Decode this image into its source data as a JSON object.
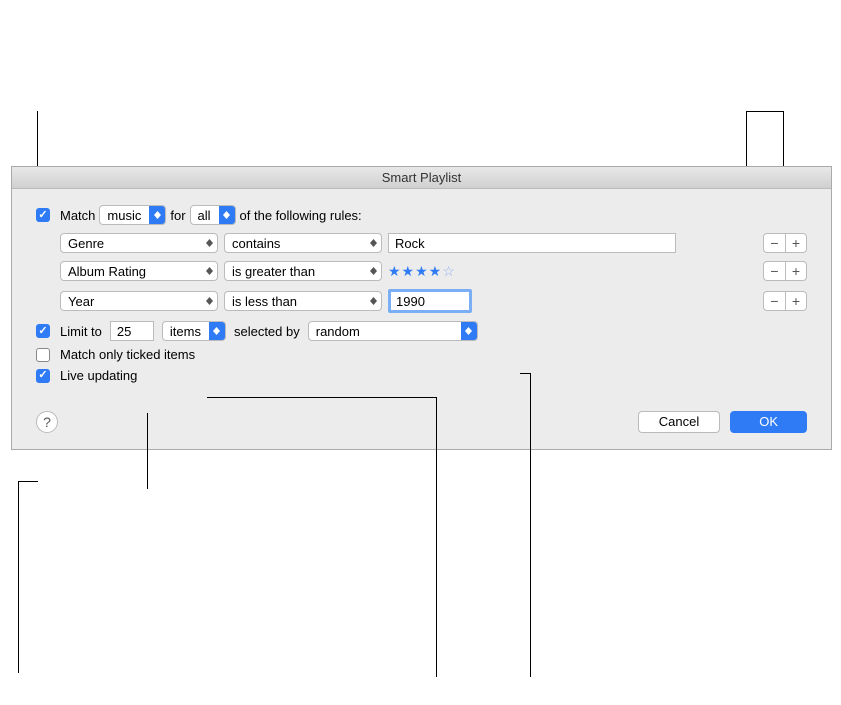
{
  "window": {
    "title": "Smart Playlist"
  },
  "match": {
    "label_match": "Match",
    "media_type": "music",
    "label_for": "for",
    "quantifier": "all",
    "label_rules": "of the following rules:",
    "checked": true
  },
  "rules": [
    {
      "field": "Genre",
      "operator": "contains",
      "value_type": "text",
      "value": "Rock"
    },
    {
      "field": "Album Rating",
      "operator": "is greater than",
      "value_type": "stars",
      "stars": 4,
      "max_stars": 5
    },
    {
      "field": "Year",
      "operator": "is less than",
      "value_type": "text-focused",
      "value": "1990"
    }
  ],
  "limit": {
    "checked": true,
    "label": "Limit to",
    "count": "25",
    "unit": "items",
    "selected_by_label": "selected by",
    "selected_by": "random"
  },
  "match_only_ticked": {
    "checked": false,
    "label": "Match only ticked items"
  },
  "live_updating": {
    "checked": true,
    "label": "Live updating"
  },
  "buttons": {
    "cancel": "Cancel",
    "ok": "OK",
    "help": "?"
  },
  "icons": {
    "minus": "−",
    "plus": "+"
  }
}
